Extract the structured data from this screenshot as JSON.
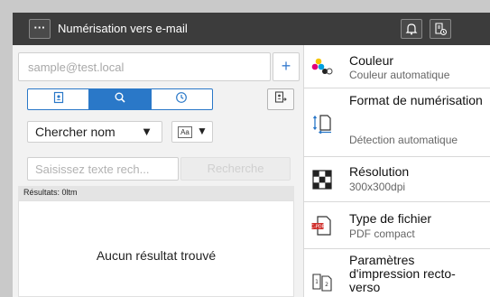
{
  "header": {
    "menu_icon_label": "···",
    "title": "Numérisation vers e-mail",
    "bell_icon": "bell-icon",
    "settings_icon": "job-settings-icon"
  },
  "left": {
    "email_placeholder": "sample@test.local",
    "add_button": "+",
    "tabs": [
      {
        "name": "address-book",
        "icon": "address-book-icon",
        "active": false
      },
      {
        "name": "search",
        "icon": "search-icon",
        "active": true
      },
      {
        "name": "history",
        "icon": "clock-icon",
        "active": false
      }
    ],
    "search_by": "Chercher nom",
    "search_by_arrow": "▼",
    "case_label": "Aa",
    "case_arrow": "▼",
    "search_placeholder": "Saisissez texte rech...",
    "search_button": "Recherche",
    "results_label": "Résultats: 0ltm",
    "no_results": "Aucun résultat trouvé"
  },
  "settings": [
    {
      "label": "Couleur",
      "value": "Couleur automatique",
      "icon": "color-dots-icon"
    },
    {
      "label": "Format de numérisation",
      "value": "Détection automatique",
      "icon": "scan-size-icon"
    },
    {
      "label": "Résolution",
      "value": "300x300dpi",
      "icon": "resolution-icon"
    },
    {
      "label": "Type de fichier",
      "value": "PDF compact",
      "icon": "pdf-file-icon"
    },
    {
      "label": "Paramètres d'impression recto-verso",
      "value": "",
      "icon": "duplex-icon"
    }
  ],
  "colors": {
    "accent": "#2a78c8",
    "header": "#3c3c3c"
  }
}
